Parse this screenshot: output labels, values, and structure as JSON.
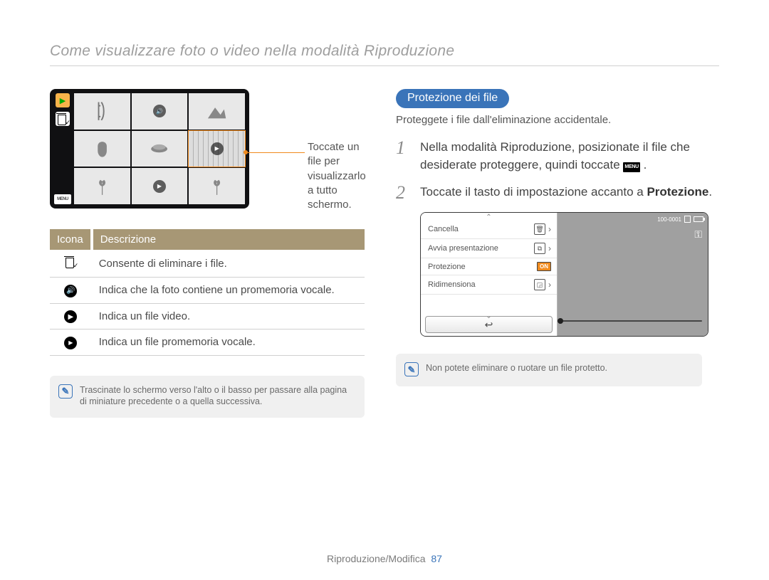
{
  "page_title": "Come visualizzare foto o video nella modalità Riproduzione",
  "left": {
    "menu_label": "MENU",
    "callout": "Toccate un file per visualizzarlo a tutto schermo.",
    "table": {
      "head_icon": "Icona",
      "head_desc": "Descrizione",
      "rows": [
        {
          "icon": "trash-check",
          "desc": "Consente di eliminare i file."
        },
        {
          "icon": "voice-memo",
          "desc": "Indica che la foto contiene un promemoria vocale."
        },
        {
          "icon": "video-play",
          "desc": "Indica un file video."
        },
        {
          "icon": "memo-play",
          "desc": "Indica un file promemoria vocale."
        }
      ]
    },
    "tip": "Trascinate lo schermo verso l'alto o il basso per passare alla pagina di miniature precedente o a quella successiva."
  },
  "right": {
    "section_title": "Protezione dei file",
    "section_intro": "Proteggete i file dall'eliminazione accidentale.",
    "steps": [
      {
        "num": "1",
        "text_before": "Nella modalità Riproduzione, posizionate il file che desiderate proteggere, quindi toccate ",
        "menu_label": "MENU",
        "text_after": " ."
      },
      {
        "num": "2",
        "text_before": "Toccate il tasto di impostazione accanto a ",
        "bold": "Protezione",
        "text_after": "."
      }
    ],
    "camera_menu": {
      "status_id": "100-0001",
      "items": [
        {
          "label": "Cancella",
          "glyph": "trash",
          "extra": "arrow"
        },
        {
          "label": "Avvia presentazione",
          "glyph": "slideshow",
          "extra": "arrow"
        },
        {
          "label": "Protezione",
          "glyph": "",
          "extra": "on",
          "on_label": "ON"
        },
        {
          "label": "Ridimensiona",
          "glyph": "resize",
          "extra": "arrow"
        }
      ],
      "back_glyph": "↩"
    },
    "tip": "Non potete eliminare o ruotare un file protetto."
  },
  "footer": {
    "section": "Riproduzione/Modifica",
    "page": "87"
  }
}
